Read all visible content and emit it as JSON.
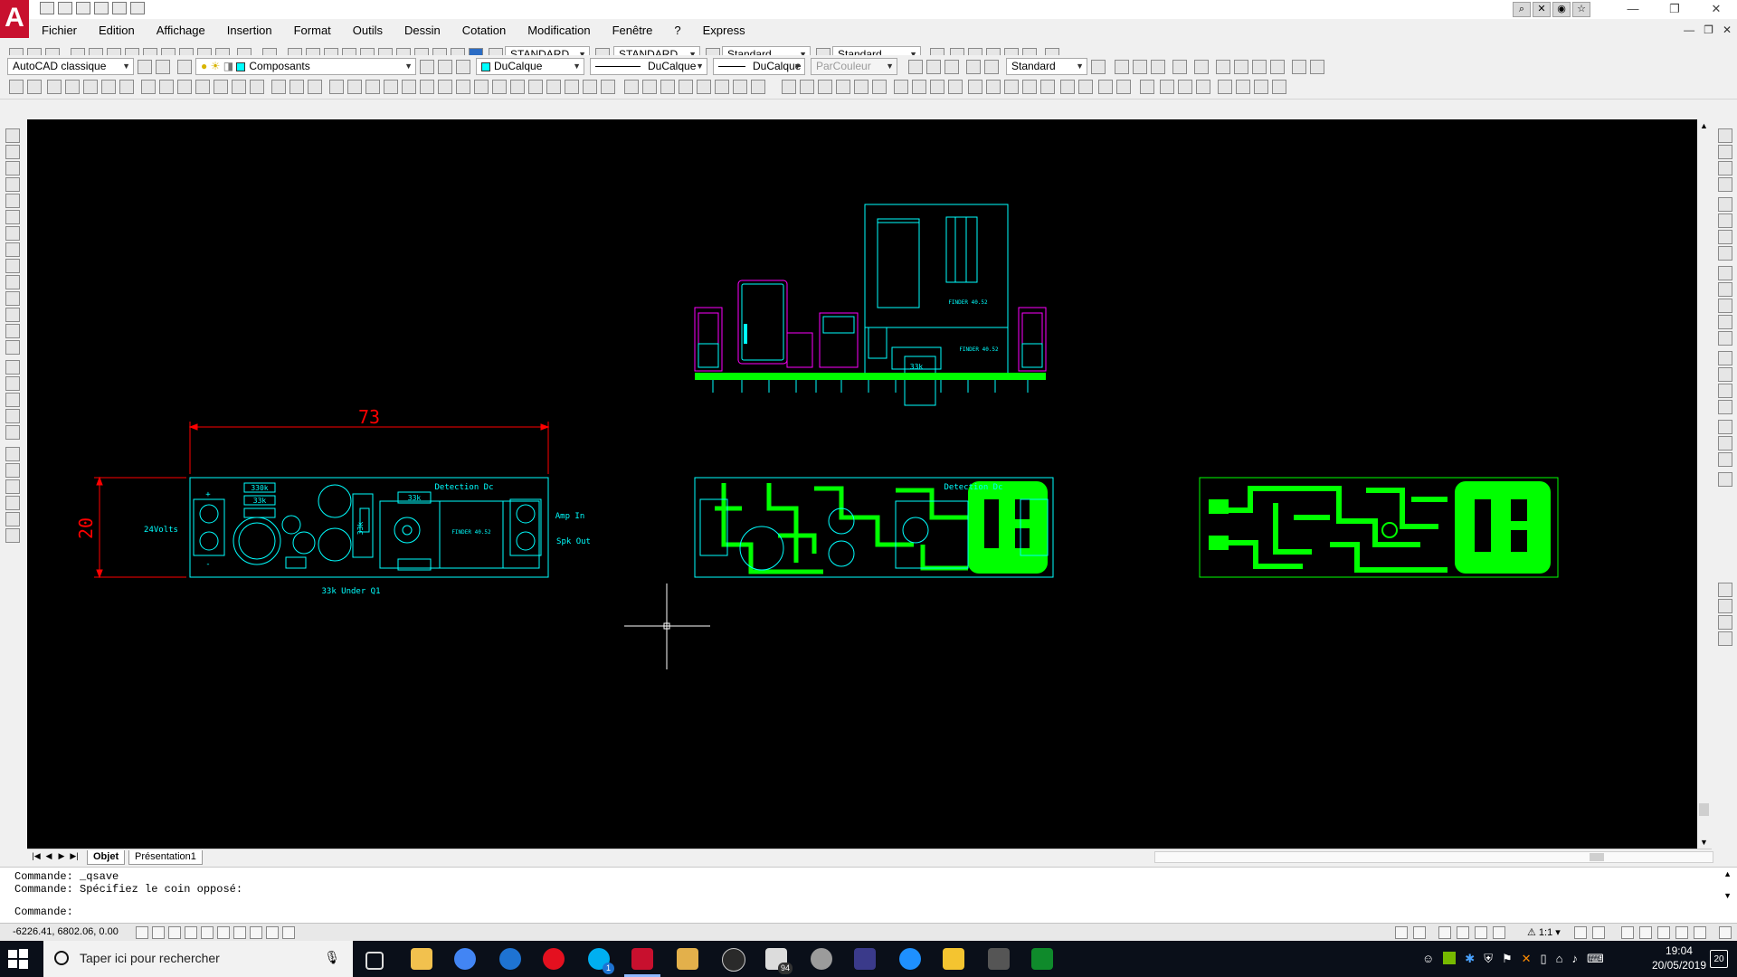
{
  "app": {
    "logo_letter": "A",
    "accent": "#c8102e"
  },
  "menu": [
    "Fichier",
    "Edition",
    "Affichage",
    "Insertion",
    "Format",
    "Outils",
    "Dessin",
    "Cotation",
    "Modification",
    "Fenêtre",
    "?",
    "Express"
  ],
  "toolbar1": {
    "text_style": "STANDARD",
    "dim_style": "STANDARD",
    "table_style": "Standard",
    "mleader_style": "Standard"
  },
  "toolbar2": {
    "workspace": "AutoCAD classique",
    "layer": "Composants",
    "color": "DuCalque",
    "linetype": "DuCalque",
    "lineweight": "DuCalque",
    "plotstyle": "ParCouleur",
    "style2": "Standard"
  },
  "drawing": {
    "dim_length": "73",
    "dim_height": "20",
    "label_24v": "24Volts",
    "label_detection": "Detection Dc",
    "label_detection2": "Detection Dc",
    "label_amp_in": "Amp In",
    "label_spk_out": "Spk Out",
    "label_under": "33k Under Q1",
    "r_330k": "330k",
    "r_33k": "33k",
    "r_33k_b": "33k",
    "r_33k_c": "33k",
    "r_33k_side": "33k",
    "finder_top": "FINDER 40.52",
    "finder_front": "FINDER 40.52",
    "finder_pcb": "FINDER 40.52",
    "plus": "+",
    "minus": "-",
    "colors": {
      "cyan": "#00ffff",
      "magenta": "#ff00ff",
      "green": "#00ff00",
      "red": "#ff0000",
      "background": "#000000"
    }
  },
  "tabs": {
    "model": "Objet",
    "layout": "Présentation1"
  },
  "command": {
    "line1": "Commande: _qsave",
    "line2": "Commande: Spécifiez le coin opposé:",
    "prompt": "Commande:"
  },
  "status": {
    "coords": "-6226.41, 6802.06, 0.00",
    "scale": "1:1"
  },
  "taskbar": {
    "search_placeholder": "Taper ici pour rechercher",
    "time": "19:04",
    "date": "20/05/2019",
    "notifications": "20",
    "skype_badge": "1",
    "mail_badge": "94"
  }
}
